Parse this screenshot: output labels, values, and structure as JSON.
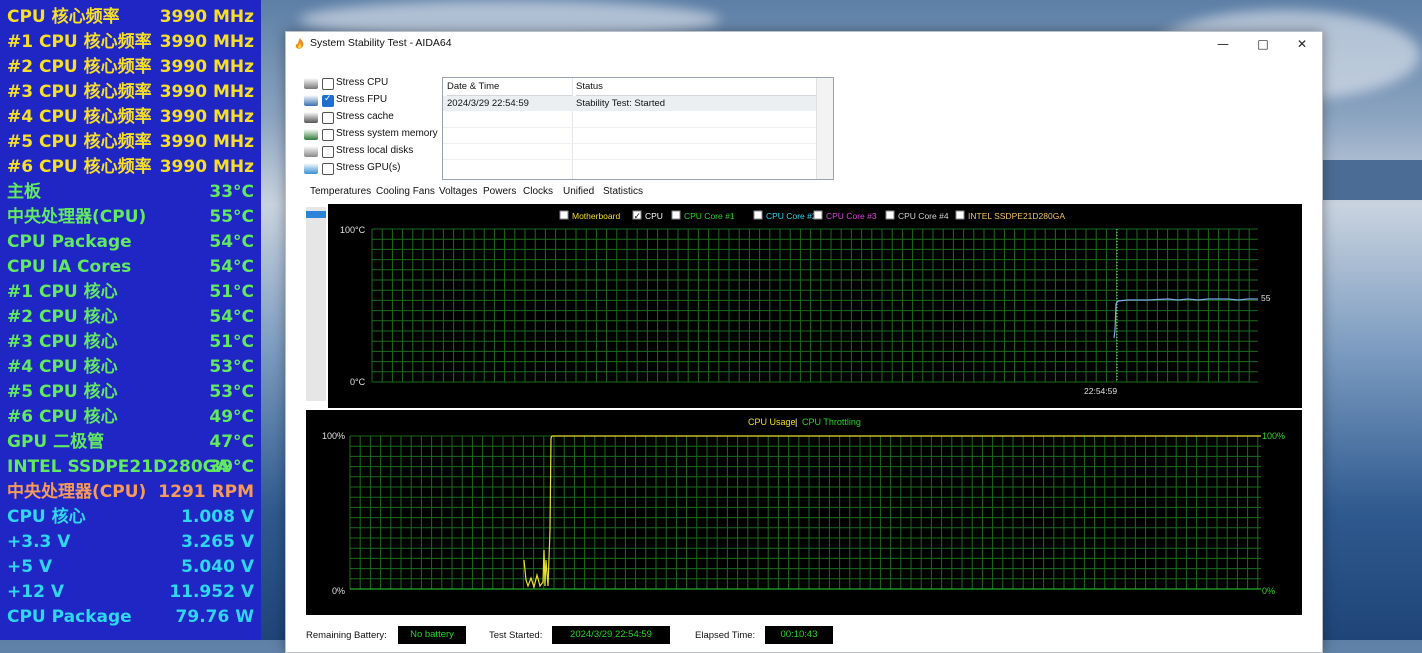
{
  "osd": {
    "rows": [
      {
        "label": "CPU 核心频率",
        "value": "3990 MHz",
        "color": "#f6df2a"
      },
      {
        "label": "#1 CPU 核心频率",
        "value": "3990 MHz",
        "color": "#f6df2a"
      },
      {
        "label": "#2 CPU 核心频率",
        "value": "3990 MHz",
        "color": "#f6df2a"
      },
      {
        "label": "#3 CPU 核心频率",
        "value": "3990 MHz",
        "color": "#f6df2a"
      },
      {
        "label": "#4 CPU 核心频率",
        "value": "3990 MHz",
        "color": "#f6df2a"
      },
      {
        "label": "#5 CPU 核心频率",
        "value": "3990 MHz",
        "color": "#f6df2a"
      },
      {
        "label": "#6 CPU 核心频率",
        "value": "3990 MHz",
        "color": "#f6df2a"
      },
      {
        "label": "主板",
        "value": "33°C",
        "color": "#62e861"
      },
      {
        "label": "中央处理器(CPU)",
        "value": "55°C",
        "color": "#62e861"
      },
      {
        "label": "CPU Package",
        "value": "54°C",
        "color": "#62e861"
      },
      {
        "label": "CPU IA Cores",
        "value": "54°C",
        "color": "#62e861"
      },
      {
        "label": " #1 CPU 核心",
        "value": "51°C",
        "color": "#62e861"
      },
      {
        "label": " #2 CPU 核心",
        "value": "54°C",
        "color": "#62e861"
      },
      {
        "label": " #3 CPU 核心",
        "value": "51°C",
        "color": "#62e861"
      },
      {
        "label": " #4 CPU 核心",
        "value": "53°C",
        "color": "#62e861"
      },
      {
        "label": " #5 CPU 核心",
        "value": "53°C",
        "color": "#62e861"
      },
      {
        "label": " #6 CPU 核心",
        "value": "49°C",
        "color": "#62e861"
      },
      {
        "label": "GPU 二极管",
        "value": "47°C",
        "color": "#62e861"
      },
      {
        "label": "INTEL SSDPE21D280GA",
        "value": "39°C",
        "color": "#62e861"
      },
      {
        "label": "中央处理器(CPU)",
        "value": "1291 RPM",
        "color": "#f59a5a"
      },
      {
        "label": "CPU 核心",
        "value": "1.008 V",
        "color": "#2fd7ee"
      },
      {
        "label": "+3.3 V",
        "value": "3.265 V",
        "color": "#2fd7ee"
      },
      {
        "label": "+5 V",
        "value": "5.040 V",
        "color": "#2fd7ee"
      },
      {
        "label": "+12 V",
        "value": "11.952 V",
        "color": "#2fd7ee"
      },
      {
        "label": "CPU Package",
        "value": "79.76 W",
        "color": "#2fd7ee"
      }
    ]
  },
  "window": {
    "title": "System Stability Test - AIDA64",
    "minimize_icon": "minimize-icon",
    "maximize_icon": "maximize-icon",
    "close_icon": "close-icon"
  },
  "stress_options": [
    {
      "label": "Stress CPU",
      "checked": false,
      "icon": "cpu-icon"
    },
    {
      "label": "Stress FPU",
      "checked": true,
      "icon": "fpu-icon"
    },
    {
      "label": "Stress cache",
      "checked": false,
      "icon": "cache-icon"
    },
    {
      "label": "Stress system memory",
      "checked": false,
      "icon": "memory-icon"
    },
    {
      "label": "Stress local disks",
      "checked": false,
      "icon": "disk-icon"
    },
    {
      "label": "Stress GPU(s)",
      "checked": false,
      "icon": "gpu-icon"
    }
  ],
  "status_table": {
    "columns": [
      "Date & Time",
      "Status"
    ],
    "rows": [
      [
        "2024/3/29 22:54:59",
        "Stability Test: Started"
      ]
    ]
  },
  "tabs": [
    "Temperatures",
    "Cooling Fans",
    "Voltages",
    "Powers",
    "Clocks",
    "Unified",
    "Statistics"
  ],
  "active_tab": "Temperatures",
  "temp_graph": {
    "legend": [
      {
        "label": "Motherboard",
        "checked": false,
        "color": "#f6df2a"
      },
      {
        "label": "CPU",
        "checked": true,
        "color": "#ffffff"
      },
      {
        "label": "CPU Core #1",
        "checked": false,
        "color": "#27d42b"
      },
      {
        "label": "CPU Core #2",
        "checked": false,
        "color": "#2fd7ee"
      },
      {
        "label": "CPU Core #3",
        "checked": false,
        "color": "#e040e0"
      },
      {
        "label": "CPU Core #4",
        "checked": false,
        "color": "#d0d0d0"
      },
      {
        "label": "INTEL SSDPE21D280GA",
        "checked": false,
        "color": "#f0c060"
      }
    ],
    "y_top_label": "100°C",
    "y_bottom_label": "0°C",
    "time_label": "22:54:59",
    "current_value_label": "55"
  },
  "usage_graph": {
    "title_left": "CPU Usage",
    "title_sep": "|",
    "title_right": "CPU Throttling",
    "title_left_color": "#f6df2a",
    "title_right_color": "#27d42b",
    "y_top_left": "100%",
    "y_bottom_left": "0%",
    "y_top_right": "100%",
    "y_bottom_right": "0%"
  },
  "bottom_bar": {
    "battery_label": "Remaining Battery:",
    "battery_value": "No battery",
    "started_label": "Test Started:",
    "started_value": "2024/3/29 22:54:59",
    "elapsed_label": "Elapsed Time:",
    "elapsed_value": "00:10:43"
  }
}
